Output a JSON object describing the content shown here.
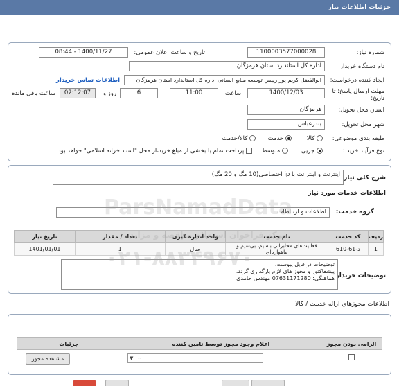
{
  "header": {
    "title": "جزئیات اطلاعات نیاز"
  },
  "need_number": {
    "label": "شماره نیاز:",
    "value": "1100003577000028"
  },
  "announce": {
    "label": "تاریخ و ساعت اعلان عمومی:",
    "value": "1400/11/27 - 08:44"
  },
  "buyer": {
    "label": "نام دستگاه خریدار:",
    "value": "اداره کل استاندارد استان هرمزگان"
  },
  "creator": {
    "label": "ایجاد کننده درخواست:",
    "value": "ابوالفضل کریم پور رییس توسعه منابع انسانی اداره کل استاندارد استان هرمزگان",
    "contact_link": "اطلاعات تماس خریدار"
  },
  "deadline": {
    "label": "مهلت ارسال پاسخ: تا تاریخ:",
    "date": "1400/12/03",
    "time_label": "ساعت",
    "time": "11:00",
    "days": "6",
    "days_label": "روز و",
    "remaining": "02:12:07",
    "remaining_label": "ساعت باقی مانده"
  },
  "province": {
    "label": "استان محل تحویل:",
    "value": "هرمزگان"
  },
  "city": {
    "label": "شهر محل تحویل:",
    "value": "بندرعباس"
  },
  "category": {
    "label": "طبقه بندی موضوعی:",
    "options": [
      "کالا",
      "خدمت",
      "کالا/خدمت"
    ],
    "selected": "خدمت"
  },
  "process": {
    "label": "نوع فرآیند خرید :",
    "options": [
      "جزیی",
      "متوسط"
    ],
    "selected": "جزیی",
    "note": "پرداخت تمام یا بخشی از مبلغ خرید،از محل \"اسناد خزانه اسلامی\" خواهد بود."
  },
  "summary": {
    "label": "شرح کلی نیاز:",
    "value": "اینترنت و اینترانت با ip اختصاصی(10 مگ و 20 مگ)"
  },
  "services_title": "اطلاعات خدمات مورد نیاز",
  "service_group": {
    "label": "گروه خدمت:",
    "value": "اطلاعات و ارتباطات"
  },
  "table": {
    "headers": [
      "ردیف",
      "کد خدمت",
      "نام خدمت",
      "واحد اندازه گیری",
      "تعداد / مقدار",
      "تاریخ نیاز"
    ],
    "rows": [
      [
        "1",
        "د-61-610",
        "فعالیت‌های مخابراتی باسیم، بی‌سیم و ماهواره‌ای",
        "سال",
        "1",
        "1401/01/01"
      ]
    ]
  },
  "buyer_notes": {
    "label": "توضیحات خریدار:",
    "lines": [
      "توضیحات در فایل پیوست.",
      "پیشفاکتور و مجوز های لازم بارگذاری گردد.",
      "هماهنگی: 07631171280 مهندس حامدی"
    ]
  },
  "permits": {
    "title": "اطلاعات مجوزهای ارائه خدمت / کالا",
    "headers": [
      "الزامی بودن مجوز",
      "اعلام وجود مجوز توسط تامین کننده",
      "جزئیات"
    ],
    "view_button": "مشاهده مجوز"
  },
  "colors": {
    "header": "#5a79a6",
    "link": "#2060c0",
    "table_header": "#d9d9d9"
  },
  "watermark": {
    "text": "ParsNamadData",
    "phone": "۰۲۱-۸۸۳۴۹۶۷۰",
    "line2": "مرکز فراخوان استعلام مناقصه و مزایده"
  }
}
